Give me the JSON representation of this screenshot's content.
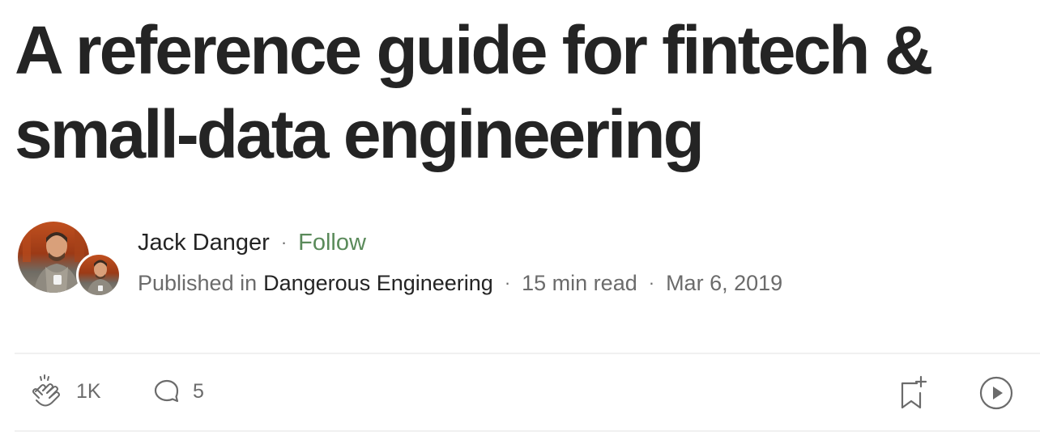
{
  "article": {
    "title": "A reference guide for fintech & small-data engineering"
  },
  "author": {
    "name": "Jack Danger",
    "follow_label": "Follow",
    "separator": "·"
  },
  "publication": {
    "prefix": "Published in",
    "name": "Dangerous Engineering"
  },
  "meta": {
    "read_time": "15 min read",
    "date": "Mar 6, 2019",
    "separator": "·"
  },
  "actions": {
    "claps": "1K",
    "responses": "5",
    "icons": [
      "clap-icon",
      "response-icon",
      "bookmark-add-icon",
      "play-icon"
    ]
  },
  "colors": {
    "text": "#242424",
    "muted": "#6b6b6b",
    "follow": "#5a8a5a",
    "divider": "#f0f0f0"
  }
}
